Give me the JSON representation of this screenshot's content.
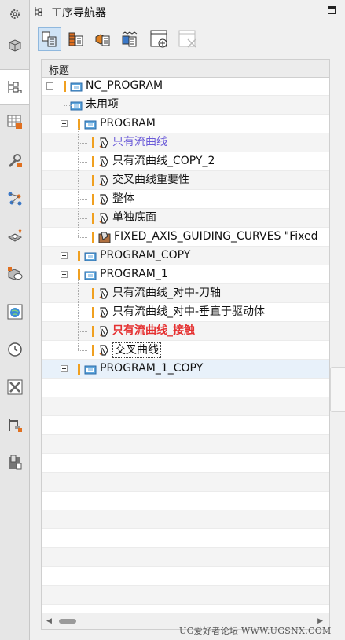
{
  "navigator": {
    "title": "工序导航器",
    "column_header": "标题"
  },
  "left_bar": [
    "settings-icon",
    "part-icon",
    "operation-navigator-icon",
    "machine-table-icon",
    "tool-wrench-icon",
    "process-flow-icon",
    "cam-part-icon",
    "simulation-icon",
    "globe-browser-icon",
    "history-clock-icon",
    "tools-icon",
    "machine-tool-icon",
    "palette-icon"
  ],
  "toolbar": [
    "program-order-view-icon",
    "machine-tool-view-icon",
    "geometry-view-icon",
    "method-view-icon",
    "create-operation-icon",
    "delete-icon"
  ],
  "tree": [
    {
      "label": "NC_PROGRAM",
      "level": 0
    },
    {
      "label": "未用项",
      "level": 1
    },
    {
      "label": "PROGRAM",
      "level": 1
    },
    {
      "label": "只有流曲线",
      "level": 2
    },
    {
      "label": "只有流曲线_COPY_2",
      "level": 2
    },
    {
      "label": "交叉曲线重要性",
      "level": 2
    },
    {
      "label": "整体",
      "level": 2
    },
    {
      "label": "单独底面",
      "level": 2
    },
    {
      "label": "FIXED_AXIS_GUIDING_CURVES \"Fixed",
      "level": 2
    },
    {
      "label": "PROGRAM_COPY",
      "level": 1
    },
    {
      "label": "PROGRAM_1",
      "level": 1
    },
    {
      "label": "只有流曲线_对中-刀轴",
      "level": 2
    },
    {
      "label": "只有流曲线_对中-垂直于驱动体",
      "level": 2
    },
    {
      "label": "只有流曲线_接触",
      "level": 2
    },
    {
      "label": "交叉曲线",
      "level": 2
    },
    {
      "label": "PROGRAM_1_COPY",
      "level": 1
    }
  ],
  "watermark": "UG爱好者论坛 WWW.UGSNX.COM",
  "colors": {
    "accent": "#f0a020",
    "selected_text": "#6a5ad8",
    "highlight_text": "#e53030",
    "toolbar_selected": "#cfe3f6"
  }
}
